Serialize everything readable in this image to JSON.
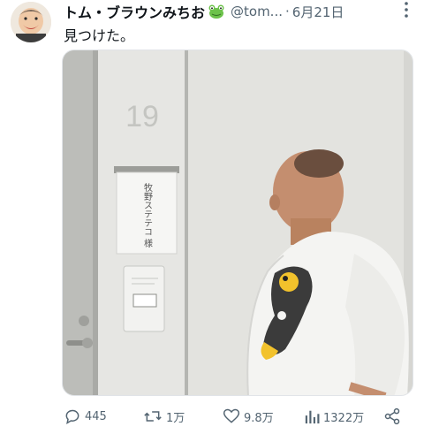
{
  "author": {
    "name": "トム・ブラウンみちお",
    "handle": "@tom...",
    "date": "6月21日"
  },
  "tweet": {
    "text": "見つけた。"
  },
  "photo": {
    "room_number": "19",
    "sign_text": "牧野ステテコ 様"
  },
  "actions": {
    "replies": "445",
    "retweets": "1万",
    "likes": "9.8万",
    "views": "1322万"
  },
  "colors": {
    "text": "#0f1419",
    "muted": "#536471",
    "wall": "#d8d9d5"
  }
}
